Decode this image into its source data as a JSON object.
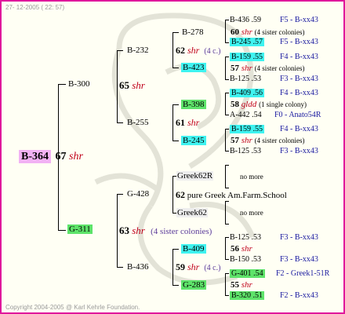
{
  "header_date": "27- 12-2005 ( 22: 57)",
  "footer": "Copyright 2004-2005 @ Karl Kehrle Foundation.",
  "colors": {
    "frame": "#e0189c",
    "cyan": "#3ff3f0",
    "green": "#5ee36a",
    "pink": "#f2b2f4",
    "red": "#c0001a",
    "blue": "#1a1aa0"
  },
  "root": {
    "code": "B-364",
    "num": "67",
    "tag": "shr"
  },
  "gen1": [
    {
      "code": "B-300",
      "num": "65",
      "tag": "shr"
    },
    {
      "code": "G-311",
      "num": "63",
      "tag": "shr",
      "note": "(4 sister colonies)"
    }
  ],
  "gen2": [
    {
      "code": "B-232",
      "num": "62",
      "tag": "shr",
      "note": "(4 c.)"
    },
    {
      "code": "B-255",
      "num": "61",
      "tag": "shr"
    },
    {
      "code": "G-428",
      "num": "62",
      "text": "pure Greek Am.Farm.School"
    },
    {
      "code": "B-436",
      "num": "59",
      "tag": "shr",
      "note": "(4 c.)"
    }
  ],
  "gen3": [
    {
      "code": "B-278",
      "num": "60",
      "tag": "shr",
      "note": "(4 sister colonies)"
    },
    {
      "code": "B-423",
      "num": "57",
      "tag": "shr",
      "note": "(4 sister colonies)"
    },
    {
      "code": "B-398",
      "num": "58",
      "tag": "gldd",
      "note": "(1 single colony)"
    },
    {
      "code": "B-245",
      "num": "57",
      "tag": "shr",
      "note": "(4 sister colonies)"
    },
    {
      "code": "Greek62R",
      "more": "no more"
    },
    {
      "code": "Greek62",
      "more": "no more"
    },
    {
      "code": "B-409",
      "num": "56",
      "tag": "shr"
    },
    {
      "code": "G-283",
      "num": "55",
      "tag": "shr"
    }
  ],
  "gen4": [
    {
      "code": "B-436",
      "num": ".59",
      "right": "F5 - B-xx43"
    },
    {
      "code": "B-245",
      "num": ".57",
      "right": "F5 - B-xx43"
    },
    {
      "code": "B-159",
      "num": ".55",
      "right": "F4 - B-xx43"
    },
    {
      "code": "B-125",
      "num": ".53",
      "right": "F3 - B-xx43"
    },
    {
      "code": "B-409",
      "num": ".56",
      "right": "F4 - B-xx43"
    },
    {
      "code": "A-442",
      "num": ".54",
      "right": "F0 - Anato54R"
    },
    {
      "code": "B-159",
      "num": ".55",
      "right": "F4 - B-xx43"
    },
    {
      "code": "B-125",
      "num": ".53",
      "right": "F3 - B-xx43"
    },
    {
      "code": "B-125",
      "num": ".53",
      "right": "F3 - B-xx43"
    },
    {
      "code": "B-150",
      "num": ".53",
      "right": "F3 - B-xx43"
    },
    {
      "code": "G-401",
      "num": ".54",
      "right": "F2 - Greek1-51R"
    },
    {
      "code": "B-320",
      "num": ".51",
      "right": "F2 - B-xx43"
    }
  ]
}
